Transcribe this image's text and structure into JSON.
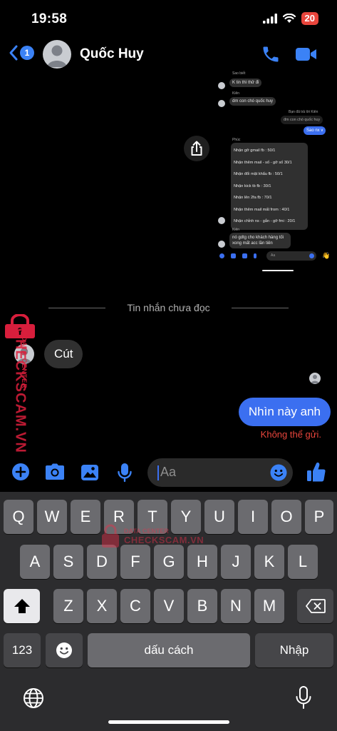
{
  "status_bar": {
    "time": "19:58",
    "battery": "20"
  },
  "header": {
    "back_count": "1",
    "contact_name": "Quốc Huy"
  },
  "embedded_screenshot": {
    "messages": [
      {
        "sender": "Sao biết",
        "text": "K tin thì thử đi"
      },
      {
        "sender": "Kiên",
        "text": "dm con chó quốc huy"
      },
      {
        "reply_note": "Bạn đã trả lời Kiên",
        "quoted": "đm con chó quốc huy",
        "text": "Sao nx v"
      }
    ],
    "list_sender": "Phúc",
    "list_items": [
      "Nhận gỡ gmail fb : 50/1",
      "Nhận thêm mail - số - gỡ số 30/1",
      "Nhận đổi mật khẩu fb : 50/1",
      "Nhận kick tb fb : 30/1",
      "Nhận lên 2fa fb : 70/1",
      "Nhận thêm mail mất from : 40/1",
      "Nhận chỉnh ns - gắn - gỡ fmi : 20/1"
    ],
    "last_sender": "Kiên",
    "last_message": "nó gdtg cho khách hàng tối xong mất acc lần tiên",
    "composer_placeholder": "Aa"
  },
  "unread_divider": "Tin nhắn chưa đọc",
  "incoming_message": "Cút",
  "outgoing_message": "Nhìn này anh",
  "send_error": "Không thể gửi.",
  "composer": {
    "placeholder": "Aa"
  },
  "watermark": {
    "main": "CHECKSCAM.VN",
    "sub": "DATA CENTER",
    "kb_top": "DATA CENTER",
    "kb_main": "CHECKSCAM.VN"
  },
  "keyboard": {
    "row1": [
      "Q",
      "W",
      "E",
      "R",
      "T",
      "Y",
      "U",
      "I",
      "O",
      "P"
    ],
    "row2": [
      "A",
      "S",
      "D",
      "F",
      "G",
      "H",
      "J",
      "K",
      "L"
    ],
    "row3": [
      "Z",
      "X",
      "C",
      "V",
      "B",
      "N",
      "M"
    ],
    "numbers_key": "123",
    "space_key": "dấu cách",
    "return_key": "Nhập"
  },
  "colors": {
    "accent": "#3b6ff0",
    "error": "#e8453c",
    "watermark": "#dc1e3c"
  }
}
